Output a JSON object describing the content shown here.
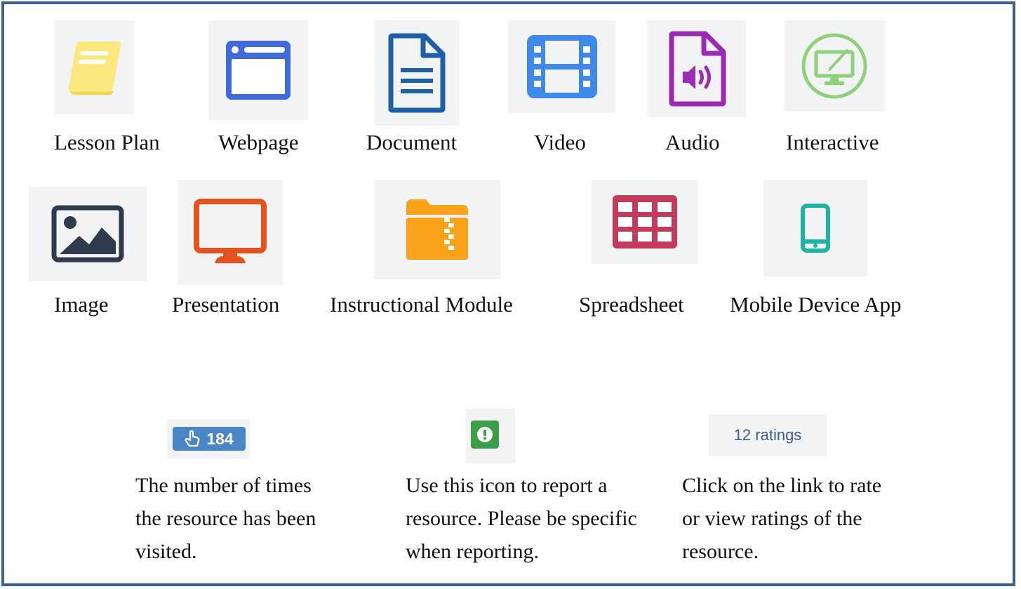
{
  "resource_types": {
    "lesson_plan": {
      "label": "Lesson Plan",
      "icon": "book-icon",
      "color": "#fde77f"
    },
    "webpage": {
      "label": "Webpage",
      "icon": "browser-window-icon",
      "color": "#3f6ad8"
    },
    "document": {
      "label": "Document",
      "icon": "document-icon",
      "color": "#1f5fa8"
    },
    "video": {
      "label": "Video",
      "icon": "film-icon",
      "color": "#3f8ae8"
    },
    "audio": {
      "label": "Audio",
      "icon": "audio-file-icon",
      "color": "#9b2bb5"
    },
    "interactive": {
      "label": "Interactive",
      "icon": "interactive-monitor-icon",
      "color": "#8fd07a"
    },
    "image": {
      "label": "Image",
      "icon": "image-icon",
      "color": "#2f3a4d"
    },
    "presentation": {
      "label": "Presentation",
      "icon": "monitor-icon",
      "color": "#e3521f"
    },
    "instructional_module": {
      "label": "Instructional Module",
      "icon": "zip-folder-icon",
      "color": "#f9a21a"
    },
    "spreadsheet": {
      "label": "Spreadsheet",
      "icon": "spreadsheet-icon",
      "color": "#c23a5c"
    },
    "mobile_device_app": {
      "label": "Mobile Device App",
      "icon": "mobile-phone-icon",
      "color": "#1fb3a3"
    }
  },
  "legend": {
    "visits": {
      "icon": "pointer-hand-icon",
      "count": "184",
      "description": "The number of times the resource has been visited.",
      "color": "#4a86c6"
    },
    "report": {
      "icon": "exclamation-icon",
      "description": "Use this icon to report a resource. Please be specific when reporting.",
      "color": "#3d9e4a"
    },
    "ratings": {
      "link_text": "12 ratings",
      "description": "Click on the link to rate or view ratings of the resource.",
      "color": "#3c5f87"
    }
  },
  "frame_color": "#3e5f8a"
}
